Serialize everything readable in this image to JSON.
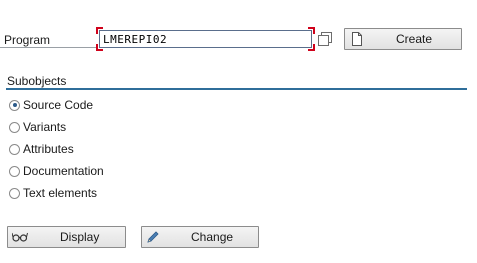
{
  "program": {
    "label": "Program",
    "value": "LMEREPI02"
  },
  "toolbar": {
    "create_label": "Create"
  },
  "subobjects": {
    "title": "Subobjects",
    "options": [
      {
        "label": "Source Code",
        "checked": true
      },
      {
        "label": "Variants",
        "checked": false
      },
      {
        "label": "Attributes",
        "checked": false
      },
      {
        "label": "Documentation",
        "checked": false
      },
      {
        "label": "Text elements",
        "checked": false
      }
    ]
  },
  "actions": {
    "display_label": "Display",
    "change_label": "Change"
  },
  "icons": {
    "value_help": "value-help-icon",
    "create": "new-document-icon",
    "display": "glasses-icon",
    "change": "pencil-icon"
  },
  "colors": {
    "accent": "#2f6e9a",
    "required_marker": "#d0021b"
  }
}
